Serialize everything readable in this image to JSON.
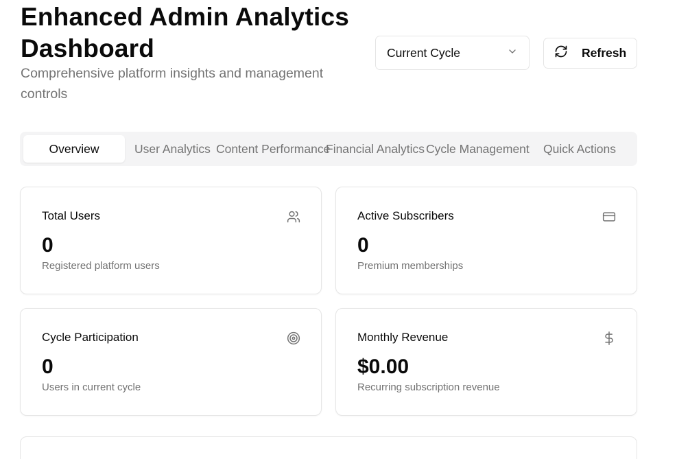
{
  "header": {
    "title": "Enhanced Admin Analytics Dashboard",
    "subtitle": "Comprehensive platform insights and management controls"
  },
  "controls": {
    "cycle_select": {
      "value": "Current Cycle",
      "icon": "chevron-down-icon"
    },
    "refresh_button": {
      "label": "Refresh",
      "icon": "refresh-icon"
    }
  },
  "tabs": [
    {
      "label": "Overview",
      "active": true
    },
    {
      "label": "User Analytics",
      "active": false
    },
    {
      "label": "Content Performance",
      "active": false
    },
    {
      "label": "Financial Analytics",
      "active": false
    },
    {
      "label": "Cycle Management",
      "active": false
    },
    {
      "label": "Quick Actions",
      "active": false
    }
  ],
  "stats": [
    {
      "title": "Total Users",
      "value": "0",
      "description": "Registered platform users",
      "icon": "users-icon"
    },
    {
      "title": "Active Subscribers",
      "value": "0",
      "description": "Premium memberships",
      "icon": "credit-card-icon"
    },
    {
      "title": "Cycle Participation",
      "value": "0",
      "description": "Users in current cycle",
      "icon": "target-icon"
    },
    {
      "title": "Monthly Revenue",
      "value": "$0.00",
      "description": "Recurring subscription revenue",
      "icon": "dollar-icon"
    }
  ],
  "colors": {
    "text_primary": "#0a0a0a",
    "text_muted": "#737373",
    "border": "#e5e5e5",
    "tab_bg": "#f4f4f5"
  }
}
